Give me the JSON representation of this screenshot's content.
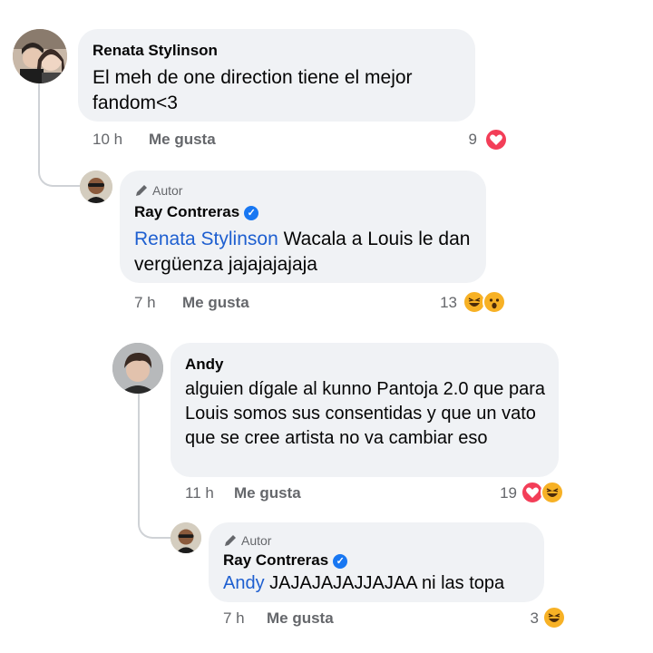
{
  "comments": [
    {
      "author": "Renata Stylinson",
      "text": "El meh de one direction tiene el mejor fandom<3",
      "time": "10 h",
      "like_label": "Me gusta",
      "reaction_count": "9",
      "reactions": [
        "heart-icon"
      ]
    },
    {
      "badge": "Autor",
      "author": "Ray Contreras",
      "verified": true,
      "mention": "Renata Stylinson",
      "text": "Wacala a Louis le dan vergüenza jajajajajaja",
      "time": "7 h",
      "like_label": "Me gusta",
      "reaction_count": "13",
      "reactions": [
        "haha-icon",
        "wow-icon"
      ]
    },
    {
      "author": "Andy",
      "text": "alguien dígale al kunno Pantoja 2.0 que para Louis somos sus consentidas y que un vato que se cree artista no va cambiar eso",
      "time": "11 h",
      "like_label": "Me gusta",
      "reaction_count": "19",
      "reactions": [
        "heart-icon",
        "haha-icon"
      ]
    },
    {
      "badge": "Autor",
      "author": "Ray Contreras",
      "verified": true,
      "mention": "Andy",
      "text": "JAJAJAJAJJAJAA ni las topa",
      "time": "7 h",
      "like_label": "Me gusta",
      "reaction_count": "3",
      "reactions": [
        "haha-icon"
      ]
    }
  ],
  "colors": {
    "bubble": "#f0f2f5",
    "mention": "#1e5fd0",
    "meta": "#65676b",
    "verified": "#1877f2",
    "love": "#f33e58",
    "haha": "#f7b125"
  }
}
